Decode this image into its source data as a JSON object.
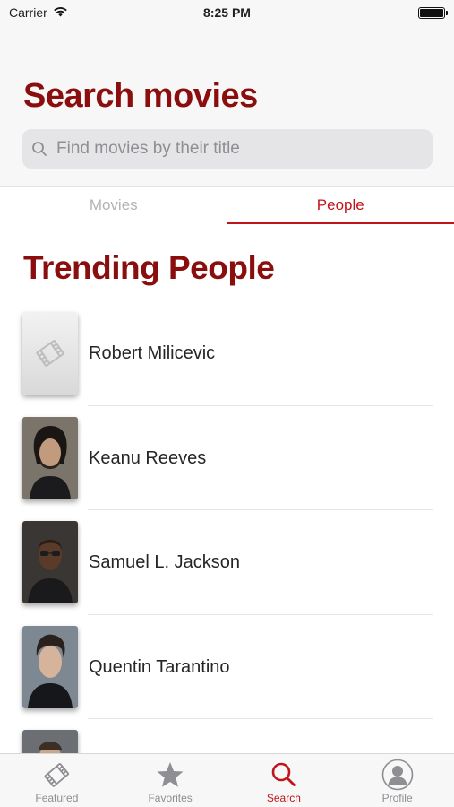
{
  "status_bar": {
    "carrier": "Carrier",
    "time": "8:25 PM"
  },
  "header": {
    "title": "Search movies",
    "search": {
      "placeholder": "Find movies by their title",
      "value": ""
    }
  },
  "segments": [
    {
      "label": "Movies",
      "selected": false
    },
    {
      "label": "People",
      "selected": true
    }
  ],
  "section": {
    "title": "Trending People"
  },
  "people": [
    {
      "name": "Robert Milicevic",
      "photo": "placeholder-film-icon"
    },
    {
      "name": "Keanu Reeves",
      "photo": "portrait"
    },
    {
      "name": "Samuel L. Jackson",
      "photo": "portrait"
    },
    {
      "name": "Quentin Tarantino",
      "photo": "portrait"
    }
  ],
  "tab_bar": {
    "tabs": [
      {
        "label": "Featured",
        "icon": "film-icon",
        "active": false
      },
      {
        "label": "Favorites",
        "icon": "star-icon",
        "active": false
      },
      {
        "label": "Search",
        "icon": "search-icon",
        "active": true
      },
      {
        "label": "Profile",
        "icon": "profile-icon",
        "active": false
      }
    ]
  },
  "colors": {
    "accent": "#c0141a",
    "title": "#8b0e0e",
    "inactive": "#8e8e93"
  }
}
